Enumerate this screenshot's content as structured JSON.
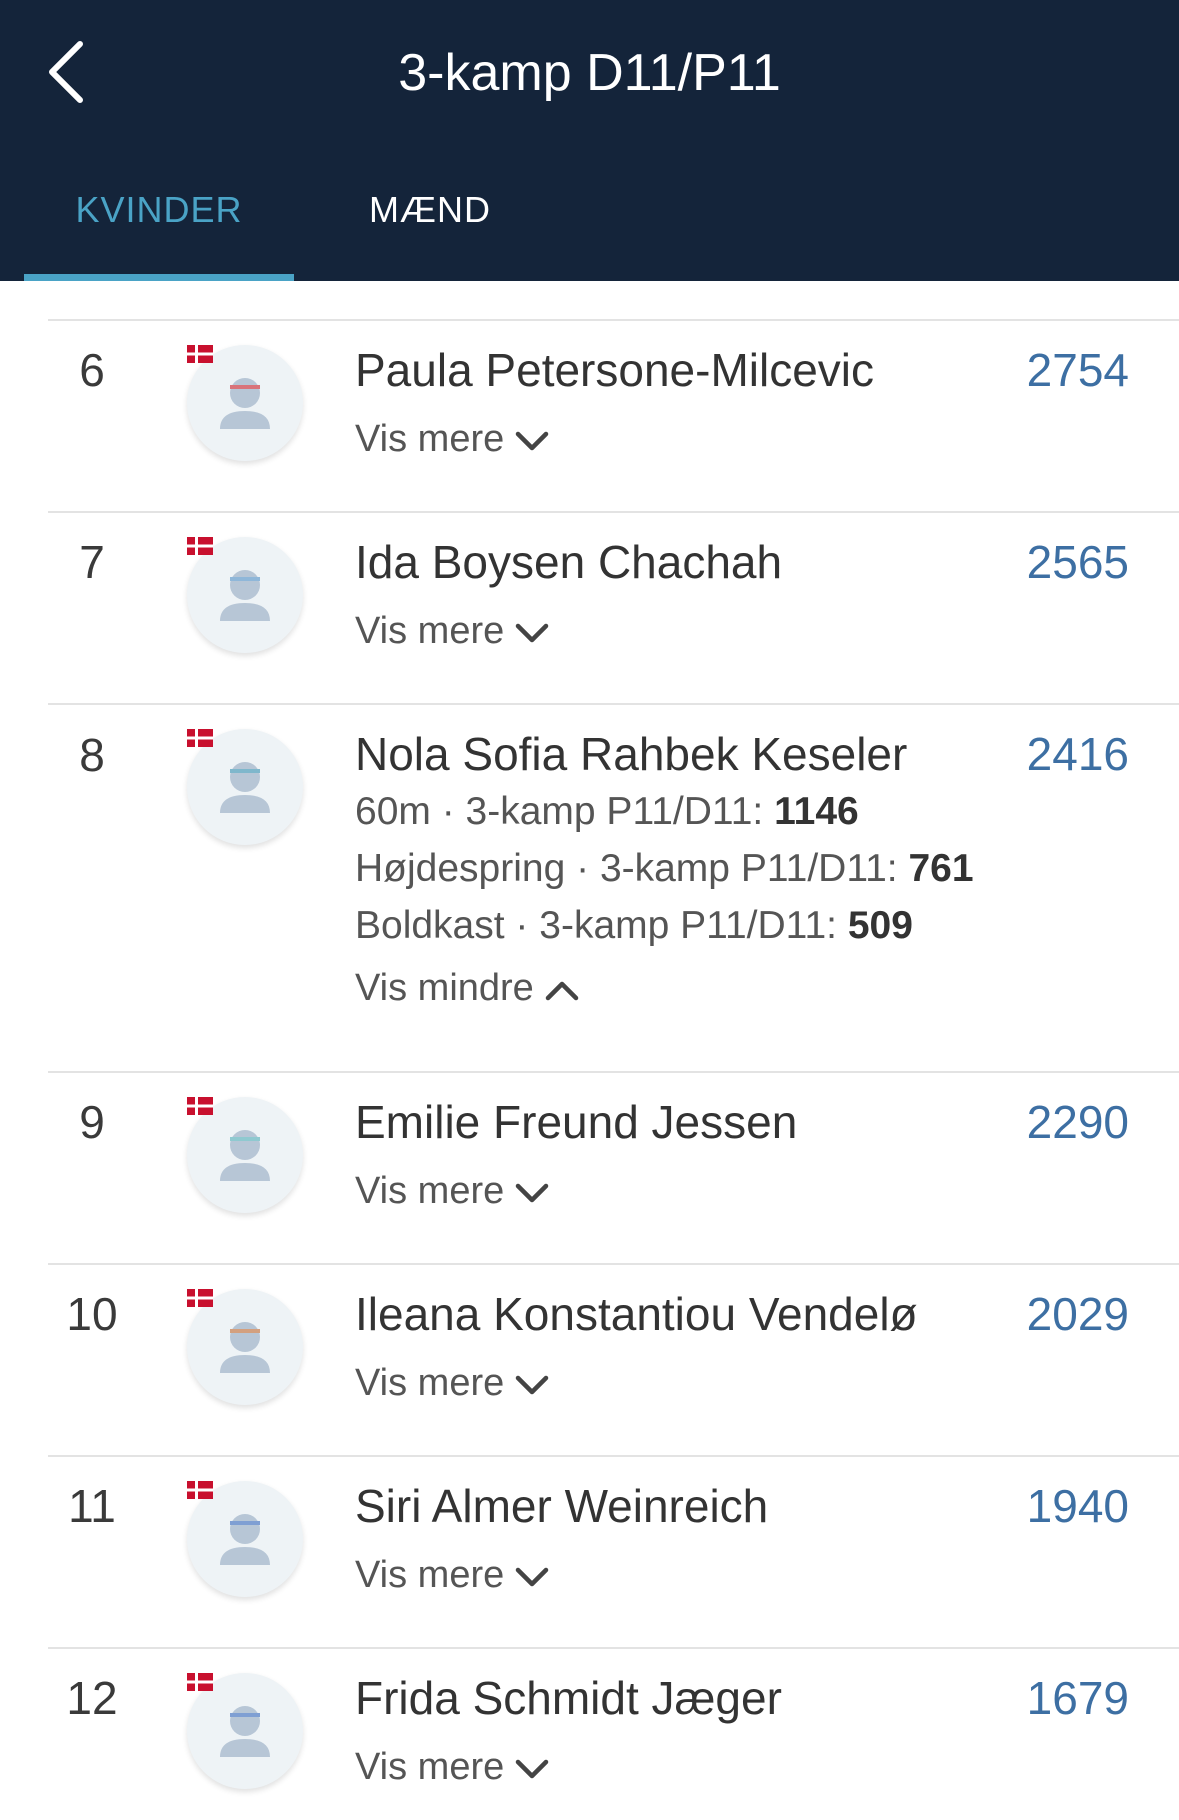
{
  "header": {
    "title": "3-kamp D11/P11",
    "tabs": [
      {
        "label": "KVINDER",
        "active": true
      },
      {
        "label": "MÆND",
        "active": false
      }
    ]
  },
  "colors": {
    "header_bg": "#14243a",
    "accent": "#4aa3c6",
    "score": "#3d6fa3",
    "flag_red": "#c8102e"
  },
  "icons": {
    "back": "chevron-left-icon",
    "avatar": "person-placeholder-icon",
    "flag": "denmark-flag-icon",
    "expand": "chevron-down-icon",
    "collapse": "chevron-up-icon"
  },
  "rows": [
    {
      "rank": "6",
      "name": "Paula Petersone-Milcevic",
      "score": "2754",
      "toggle": "Vis mere",
      "expanded": false,
      "headband": "#d9737a"
    },
    {
      "rank": "7",
      "name": "Ida Boysen Chachah",
      "score": "2565",
      "toggle": "Vis mere",
      "expanded": false,
      "headband": "#8fb7d9"
    },
    {
      "rank": "8",
      "name": "Nola Sofia Rahbek Keseler",
      "score": "2416",
      "toggle": "Vis mindre",
      "expanded": true,
      "headband": "#7fb7cc",
      "details": [
        {
          "event": "60m",
          "category": "3-kamp P11/D11:",
          "points": "1146"
        },
        {
          "event": "Højdespring",
          "category": "3-kamp P11/D11:",
          "points": "761"
        },
        {
          "event": "Boldkast",
          "category": "3-kamp P11/D11:",
          "points": "509"
        }
      ]
    },
    {
      "rank": "9",
      "name": "Emilie Freund Jessen",
      "score": "2290",
      "toggle": "Vis mere",
      "expanded": false,
      "headband": "#8fc9d0"
    },
    {
      "rank": "10",
      "name": "Ileana Konstantiou Vendelø",
      "score": "2029",
      "toggle": "Vis mere",
      "expanded": false,
      "headband": "#d3a07f"
    },
    {
      "rank": "11",
      "name": "Siri Almer Weinreich",
      "score": "1940",
      "toggle": "Vis mere",
      "expanded": false,
      "headband": "#7f9fd3"
    },
    {
      "rank": "12",
      "name": "Frida Schmidt Jæger",
      "score": "1679",
      "toggle": "Vis mere",
      "expanded": false,
      "headband": "#7f9fd3"
    }
  ]
}
